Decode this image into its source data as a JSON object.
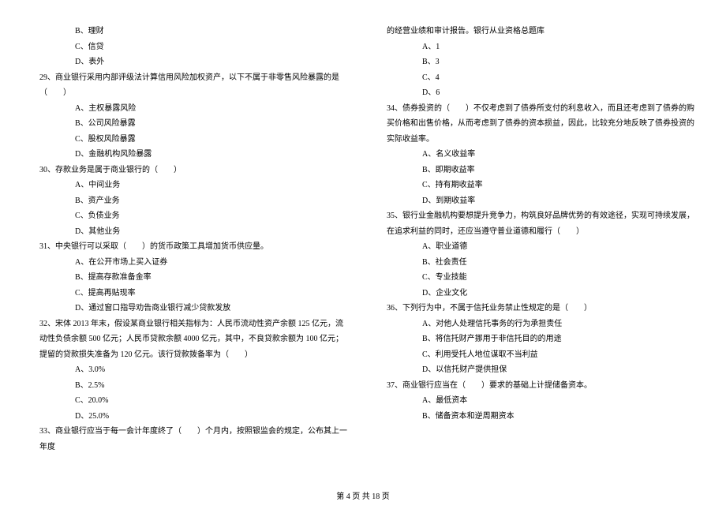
{
  "left": {
    "opt_b_prev": "B、理财",
    "opt_c_prev": "C、信贷",
    "opt_d_prev": "D、表外",
    "q29": "29、商业银行采用内部评级法计算信用风险加权资产，以下不属于非零售风险暴露的是（　　）",
    "q29a": "A、主权暴露风险",
    "q29b": "B、公司风险暴露",
    "q29c": "C、股权风险暴露",
    "q29d": "D、金融机构风险暴露",
    "q30": "30、存款业务是属于商业银行的（　　）",
    "q30a": "A、中间业务",
    "q30b": "B、资产业务",
    "q30c": "C、负债业务",
    "q30d": "D、其他业务",
    "q31": "31、中央银行可以采取（　　）的货币政策工具增加货币供应量。",
    "q31a": "A、在公开市场上买入证券",
    "q31b": "B、提高存款准备金率",
    "q31c": "C、提高再贴现率",
    "q31d": "D、通过窗口指导劝告商业银行减少贷款发放",
    "q32": "32、宋体 2013 年末，假设某商业银行相关指标为：人民币流动性资产余额 125 亿元，流动性负债余额 500 亿元；人民币贷款余额 4000 亿元，其中，不良贷款余额为 100 亿元；提留的贷款损失准备为 120 亿元。该行贷款拨备率为（　　）",
    "q32a": "A、3.0%",
    "q32b": "B、2.5%",
    "q32c": "C、20.0%",
    "q32d": "D、25.0%",
    "q33": "33、商业银行应当于每一会计年度终了（　　）个月内，按照银监会的规定，公布其上一年度"
  },
  "right": {
    "q33cont": "的经营业绩和审计报告。银行从业资格总题库",
    "q33a": "A、1",
    "q33b": "B、3",
    "q33c": "C、4",
    "q33d": "D、6",
    "q34": "34、债券投资的（　　）不仅考虑到了债券所支付的利息收入，而且还考虑到了债券的购买价格和出售价格，从而考虑到了债券的资本损益，因此，比较充分地反映了债券投资的实际收益率。",
    "q34a": "A、名义收益率",
    "q34b": "B、即期收益率",
    "q34c": "C、持有期收益率",
    "q34d": "D、到期收益率",
    "q35": "35、银行业金融机构要想提升竞争力，构筑良好品牌优势的有效途径，实现可持续发展，在追求利益的同时，还应当遵守普业道德和履行（　　）",
    "q35a": "A、职业道德",
    "q35b": "B、社会责任",
    "q35c": "C、专业技能",
    "q35d": "D、企业文化",
    "q36": "36、下列行为中，不属于信托业务禁止性规定的是（　　）",
    "q36a": "A、对他人处理信托事务的行为承担责任",
    "q36b": "B、将信托财产挪用于非信托目的的用途",
    "q36c": "C、利用受托人地位谋取不当利益",
    "q36d": "D、以信托财产提供担保",
    "q37": "37、商业银行应当在（　　）要求的基础上计提储备资本。",
    "q37a": "A、最低资本",
    "q37b": "B、储备资本和逆周期资本"
  },
  "footer": "第 4 页 共 18 页"
}
